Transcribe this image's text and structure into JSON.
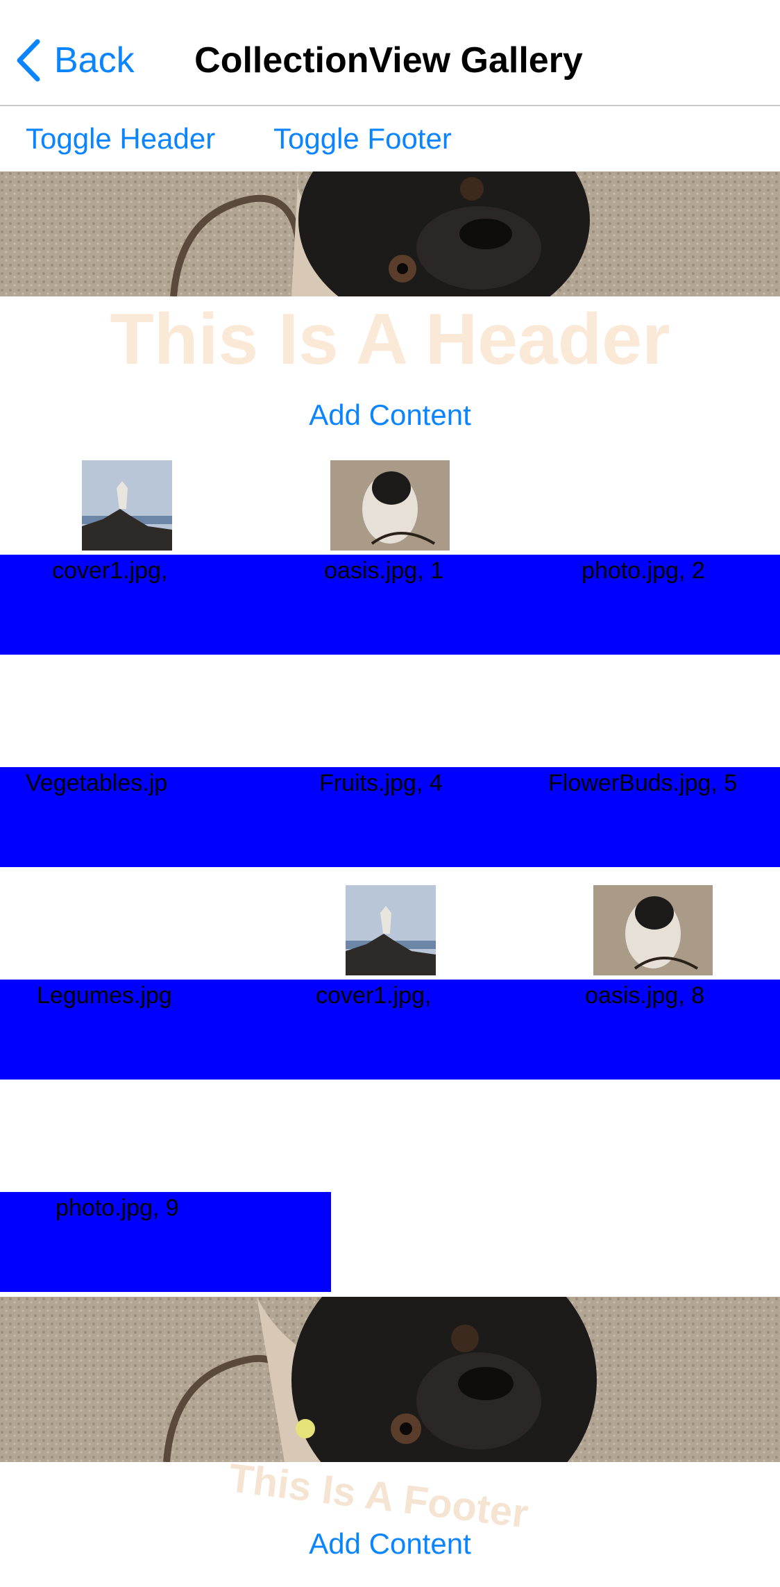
{
  "nav": {
    "back_label": "Back",
    "title": "CollectionView Gallery"
  },
  "toolbar": {
    "toggle_header": "Toggle Header",
    "toggle_footer": "Toggle Footer"
  },
  "header": {
    "title": "This Is A Header",
    "add_content": "Add Content"
  },
  "items": [
    {
      "label": "cover1.jpg,"
    },
    {
      "label": "oasis.jpg, 1"
    },
    {
      "label": "photo.jpg, 2"
    },
    {
      "label": "Vegetables.jp"
    },
    {
      "label": "Fruits.jpg, 4"
    },
    {
      "label": "FlowerBuds.jpg, 5"
    },
    {
      "label": "Legumes.jpg"
    },
    {
      "label": "cover1.jpg,"
    },
    {
      "label": "oasis.jpg, 8"
    },
    {
      "label": "photo.jpg, 9"
    }
  ],
  "footer": {
    "title": "This Is A Footer",
    "add_content": "Add Content"
  },
  "colors": {
    "accent": "#0a84ff",
    "cell_background": "#0000ff",
    "header_title": "#fbe9d8"
  }
}
